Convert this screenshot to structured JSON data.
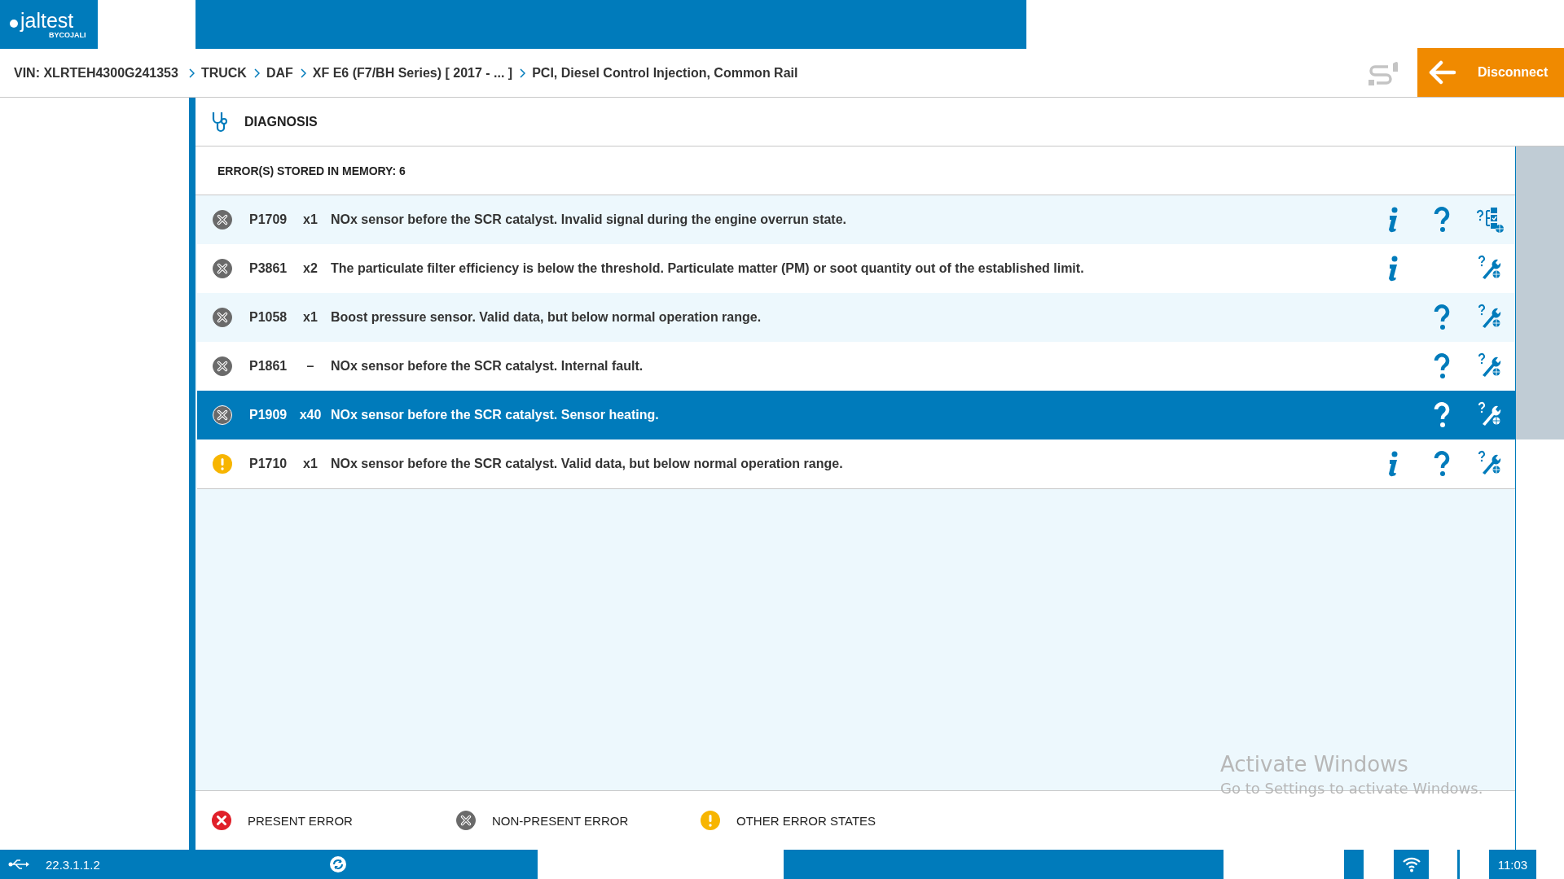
{
  "app": {
    "logo": "jaltest",
    "logo_sub": "BYCOJALI"
  },
  "breadcrumb": [
    "VIN: XLRTEH4300G241353",
    "TRUCK",
    "DAF",
    "XF E6 (F7/BH Series) [ 2017 - ... ]",
    "PCI, Diesel Control Injection, Common Rail"
  ],
  "disconnect_button": "Disconnect",
  "section": {
    "title": "DIAGNOSIS"
  },
  "errors_header": "ERROR(S) STORED IN MEMORY: 6",
  "errors": [
    {
      "kind": "non_present",
      "code": "P1709",
      "count": "x1",
      "description": "NOx sensor before the SCR catalyst. Invalid signal during the engine overrun state.",
      "info": true,
      "help": true,
      "test_plan": true,
      "selected": false
    },
    {
      "kind": "non_present",
      "code": "P3861",
      "count": "x2",
      "description": "The particulate filter efficiency is below the threshold. Particulate matter (PM) or soot quantity out of the established limit.",
      "info": true,
      "help": false,
      "test_plan": false,
      "selected": false
    },
    {
      "kind": "non_present",
      "code": "P1058",
      "count": "x1",
      "description": "Boost pressure sensor. Valid data, but below normal operation range.",
      "info": false,
      "help": true,
      "test_plan": false,
      "selected": false
    },
    {
      "kind": "non_present",
      "code": "P1861",
      "count": "–",
      "description": "NOx sensor before the SCR catalyst. Internal fault.",
      "info": false,
      "help": true,
      "test_plan": false,
      "selected": false
    },
    {
      "kind": "non_present",
      "code": "P1909",
      "count": "x40",
      "description": "NOx sensor before the SCR catalyst. Sensor heating.",
      "info": false,
      "help": true,
      "test_plan": false,
      "selected": true
    },
    {
      "kind": "other",
      "code": "P1710",
      "count": "x1",
      "description": "NOx sensor before the SCR catalyst. Valid data, but below normal operation range.",
      "info": true,
      "help": true,
      "test_plan": false,
      "selected": false
    }
  ],
  "legend": [
    {
      "kind": "present",
      "label": "PRESENT ERROR"
    },
    {
      "kind": "non_present",
      "label": "NON-PRESENT ERROR"
    },
    {
      "kind": "other",
      "label": "OTHER ERROR STATES"
    }
  ],
  "os_notice": {
    "title": "Activate Windows",
    "subtitle": "Go to Settings to activate Windows."
  },
  "status_bar": {
    "version": "22.3.1.1.2",
    "time": "11:03"
  }
}
